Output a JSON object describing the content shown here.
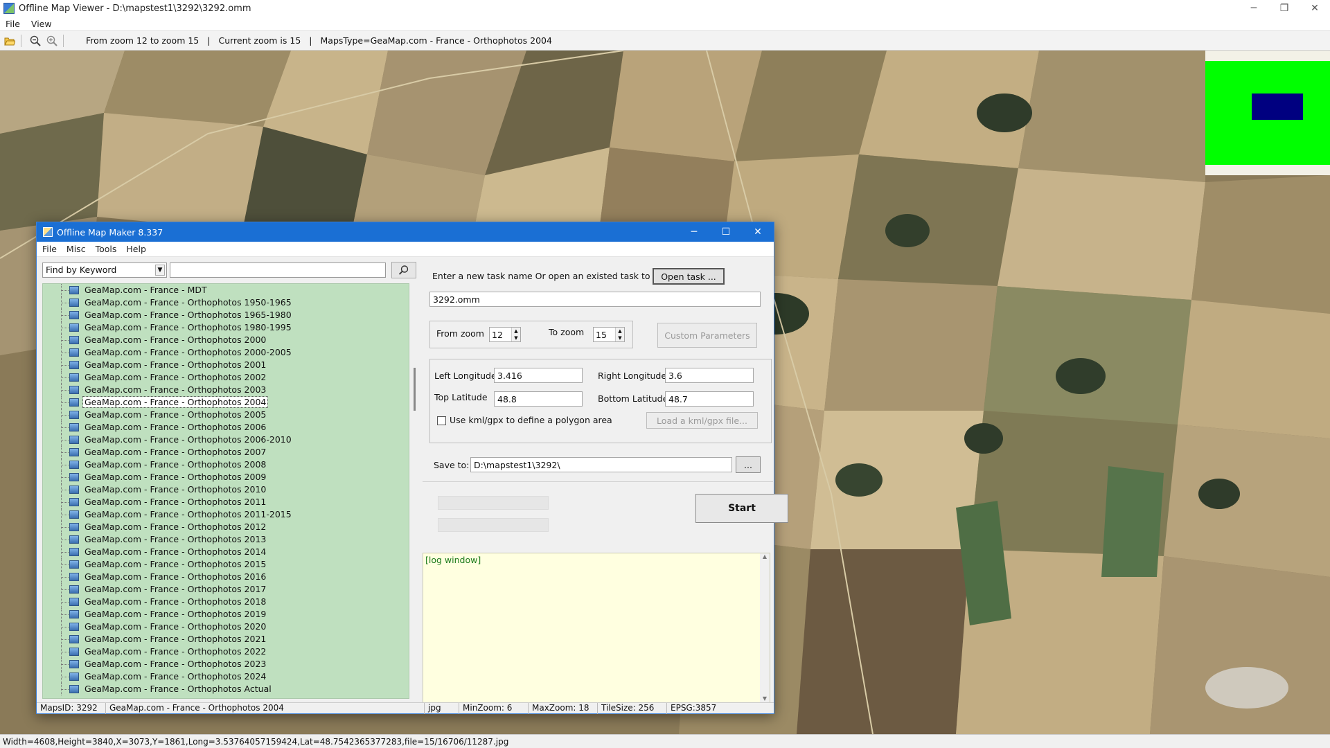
{
  "window": {
    "title": "Offline Map Viewer - D:\\mapstest1\\3292\\3292.omm",
    "controls": {
      "minimize": "─",
      "maximize": "❐",
      "close": "✕"
    }
  },
  "menu": [
    "File",
    "View"
  ],
  "toolbar": {
    "zoom_range": "From zoom 12 to zoom 15",
    "sep": "|",
    "current_zoom": "Current zoom is 15",
    "maps_type": "MapsType=GeaMap.com - France - Orthophotos 2004"
  },
  "statusbar": "Width=4608,Height=3840,X=3073,Y=1861,Long=3.53764057159424,Lat=48.7542365377283,file=15/16706/11287.jpg",
  "dialog": {
    "title": "Offline Map Maker 8.337",
    "controls": {
      "minimize": "─",
      "maximize": "☐",
      "close": "✕"
    },
    "menu": [
      "File",
      "Misc",
      "Tools",
      "Help"
    ],
    "search": {
      "mode": "Find by Keyword",
      "query": "",
      "caret": "▼"
    },
    "tree": [
      {
        "label": "GeaMap.com - France - MDT",
        "selected": false
      },
      {
        "label": "GeaMap.com - France - Orthophotos 1950-1965",
        "selected": false
      },
      {
        "label": "GeaMap.com - France - Orthophotos 1965-1980",
        "selected": false
      },
      {
        "label": "GeaMap.com - France - Orthophotos 1980-1995",
        "selected": false
      },
      {
        "label": "GeaMap.com - France - Orthophotos 2000",
        "selected": false
      },
      {
        "label": "GeaMap.com - France - Orthophotos 2000-2005",
        "selected": false
      },
      {
        "label": "GeaMap.com - France - Orthophotos 2001",
        "selected": false
      },
      {
        "label": "GeaMap.com - France - Orthophotos 2002",
        "selected": false
      },
      {
        "label": "GeaMap.com - France - Orthophotos 2003",
        "selected": false
      },
      {
        "label": "GeaMap.com - France - Orthophotos 2004",
        "selected": true
      },
      {
        "label": "GeaMap.com - France - Orthophotos 2005",
        "selected": false
      },
      {
        "label": "GeaMap.com - France - Orthophotos 2006",
        "selected": false
      },
      {
        "label": "GeaMap.com - France - Orthophotos 2006-2010",
        "selected": false
      },
      {
        "label": "GeaMap.com - France - Orthophotos 2007",
        "selected": false
      },
      {
        "label": "GeaMap.com - France - Orthophotos 2008",
        "selected": false
      },
      {
        "label": "GeaMap.com - France - Orthophotos 2009",
        "selected": false
      },
      {
        "label": "GeaMap.com - France - Orthophotos 2010",
        "selected": false
      },
      {
        "label": "GeaMap.com - France - Orthophotos 2011",
        "selected": false
      },
      {
        "label": "GeaMap.com - France - Orthophotos 2011-2015",
        "selected": false
      },
      {
        "label": "GeaMap.com - France - Orthophotos 2012",
        "selected": false
      },
      {
        "label": "GeaMap.com - France - Orthophotos 2013",
        "selected": false
      },
      {
        "label": "GeaMap.com - France - Orthophotos 2014",
        "selected": false
      },
      {
        "label": "GeaMap.com - France - Orthophotos 2015",
        "selected": false
      },
      {
        "label": "GeaMap.com - France - Orthophotos 2016",
        "selected": false
      },
      {
        "label": "GeaMap.com - France - Orthophotos 2017",
        "selected": false
      },
      {
        "label": "GeaMap.com - France - Orthophotos 2018",
        "selected": false
      },
      {
        "label": "GeaMap.com - France - Orthophotos 2019",
        "selected": false
      },
      {
        "label": "GeaMap.com - France - Orthophotos 2020",
        "selected": false
      },
      {
        "label": "GeaMap.com - France - Orthophotos 2021",
        "selected": false
      },
      {
        "label": "GeaMap.com - France - Orthophotos 2022",
        "selected": false
      },
      {
        "label": "GeaMap.com - France - Orthophotos 2023",
        "selected": false
      },
      {
        "label": "GeaMap.com - France - Orthophotos 2024",
        "selected": false
      },
      {
        "label": "GeaMap.com - France - Orthophotos Actual",
        "selected": false
      }
    ],
    "task": {
      "prompt": "Enter a new task name Or open an existed task to continue:",
      "open_button": "Open task ...",
      "name": "3292.omm"
    },
    "zoom": {
      "from_label": "From zoom",
      "from_value": "12",
      "to_label": "To zoom",
      "to_value": "15",
      "custom_button": "Custom Parameters"
    },
    "area": {
      "left_lon_label": "Left Longitude",
      "left_lon": "3.416",
      "right_lon_label": "Right Longitude",
      "right_lon": "3.6",
      "top_lat_label": "Top Latitude",
      "top_lat": "48.8",
      "bottom_lat_label": "Bottom Latitude",
      "bottom_lat": "48.7",
      "kml_label": "Use kml/gpx to define a polygon area",
      "kml_checked": false,
      "kml_button": "Load a kml/gpx file..."
    },
    "save": {
      "label": "Save to:",
      "path": "D:\\mapstest1\\3292\\",
      "browse": "..."
    },
    "start_button": "Start",
    "log": "[log window]",
    "status": {
      "maps_id": "MapsID: 3292",
      "map_name": "GeaMap.com - France - Orthophotos 2004",
      "format": "jpg",
      "min_zoom": "MinZoom: 6",
      "max_zoom": "MaxZoom: 18",
      "tile_size": "TileSize: 256",
      "epsg": "EPSG:3857"
    }
  },
  "colors": {
    "dialog_title": "#1a6fd4",
    "tree_bg": "#bfe0bf",
    "log_bg": "#ffffe0",
    "minimap_area": "#00ff00",
    "minimap_view": "#000080"
  },
  "icons": {
    "toolbar": [
      "folder-open-icon",
      "zoom-out-icon",
      "zoom-in-icon"
    ],
    "search": "magnifier-icon",
    "tree_item": "map-image-icon"
  }
}
